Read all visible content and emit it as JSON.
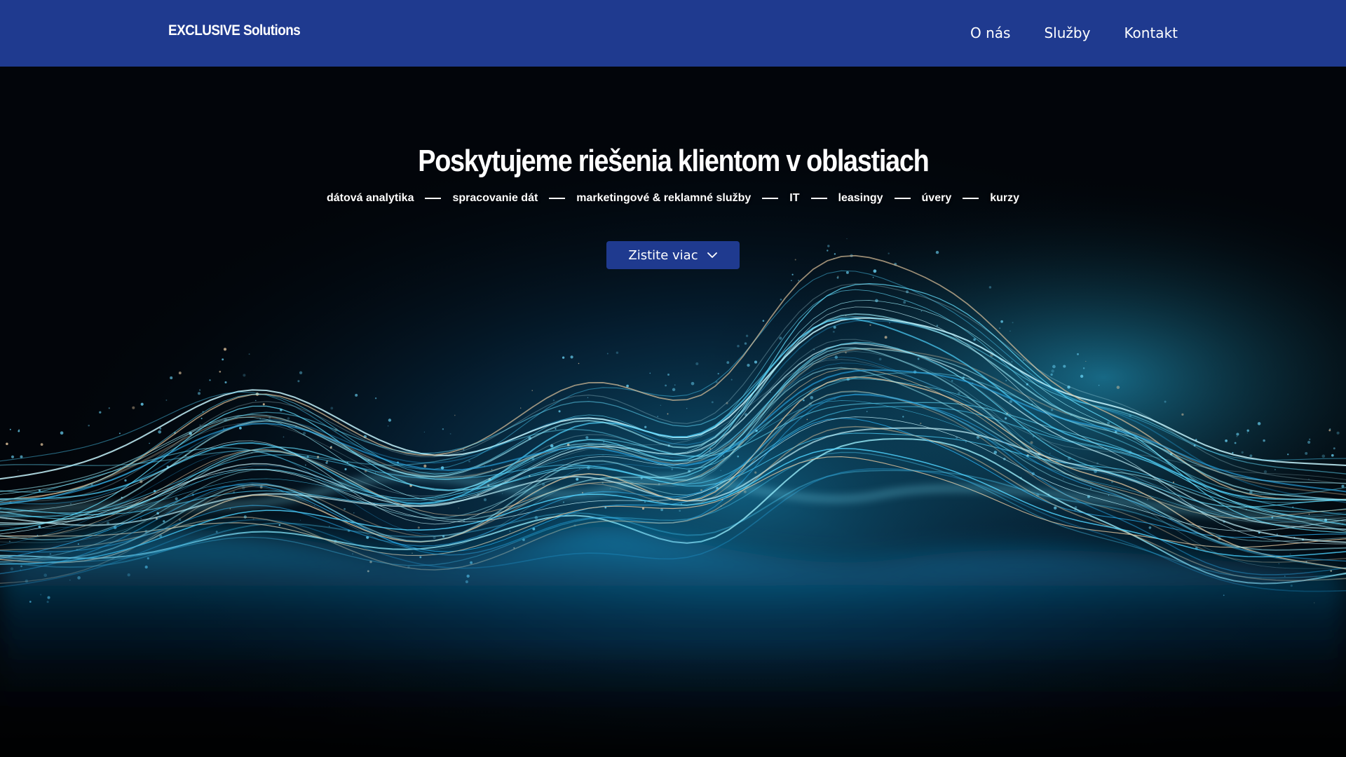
{
  "header": {
    "brand": "EXCLUSIVE Solutions",
    "nav": [
      {
        "label": "O nás"
      },
      {
        "label": "Služby"
      },
      {
        "label": "Kontakt"
      }
    ]
  },
  "hero": {
    "title": "Poskytujeme riešenia klientom v oblastiach",
    "areas": [
      "dátová analytika",
      "spracovanie dát",
      "marketingové & reklamné služby",
      "IT",
      "leasingy",
      "úvery",
      "kurzy"
    ],
    "cta_label": "Zistite viac",
    "cta_icon": "chevron-down-icon",
    "background": "glowing-cyan-data-wave-image"
  },
  "colors": {
    "brand_blue": "#1f3a8f",
    "background": "#000000",
    "accent_cyan": "#38c8f0",
    "text": "#ffffff"
  }
}
